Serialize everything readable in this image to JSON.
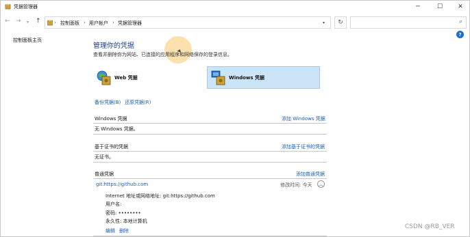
{
  "window": {
    "title": "凭据管理器",
    "minimize_glyph": "─",
    "maximize_glyph": "☐",
    "close_glyph": "✕"
  },
  "nav": {
    "back_glyph": "←",
    "forward_glyph": "→",
    "recent_glyph": "▾",
    "up_glyph": "↑",
    "breadcrumbs": [
      "控制面板",
      "用户帐户",
      "凭据管理器"
    ],
    "separator": "›",
    "address_dropdown_glyph": "▾",
    "refresh_glyph": "↻",
    "search_placeholder": "",
    "search_glyph": "⌕"
  },
  "sidebar": {
    "home_link": "控制面板主页"
  },
  "help_glyph": "?",
  "main": {
    "heading": "管理你的凭据",
    "subtext": "查看并删除你为网站、已连接的应用程序和网络保存的登录信息。",
    "tiles": {
      "web_label": "Web 凭据",
      "windows_label": "Windows 凭据"
    },
    "backup_link": "备份凭据(B)",
    "restore_link": "还原凭据(R)",
    "sections": {
      "windows": {
        "title": "Windows 凭据",
        "add_link": "添加 Windows 凭据",
        "empty": "无 Windows 凭据。"
      },
      "cert": {
        "title": "基于证书的凭据",
        "add_link": "添加基于证书的凭据",
        "empty": "无证书。"
      },
      "generic": {
        "title": "普通凭据",
        "add_link": "添加普通凭据"
      }
    },
    "credential": {
      "name": "git:https://github.com",
      "modified": "修改时间: 今天",
      "collapse_glyph": "︿",
      "address_line": "Internet 地址或网络地址:  git:https://github.com",
      "username_line": "用户名:  ",
      "password_line": "密码:  ••••••••",
      "persistence_line": "永久性:  本地计算机",
      "edit_link": "编辑",
      "delete_link": "删除"
    }
  },
  "watermark": "CSDN @RB_VER",
  "colors": {
    "accent_link": "#1a5fb4",
    "heading": "#1e3f8a",
    "selected_tile": "#cce4f7"
  }
}
